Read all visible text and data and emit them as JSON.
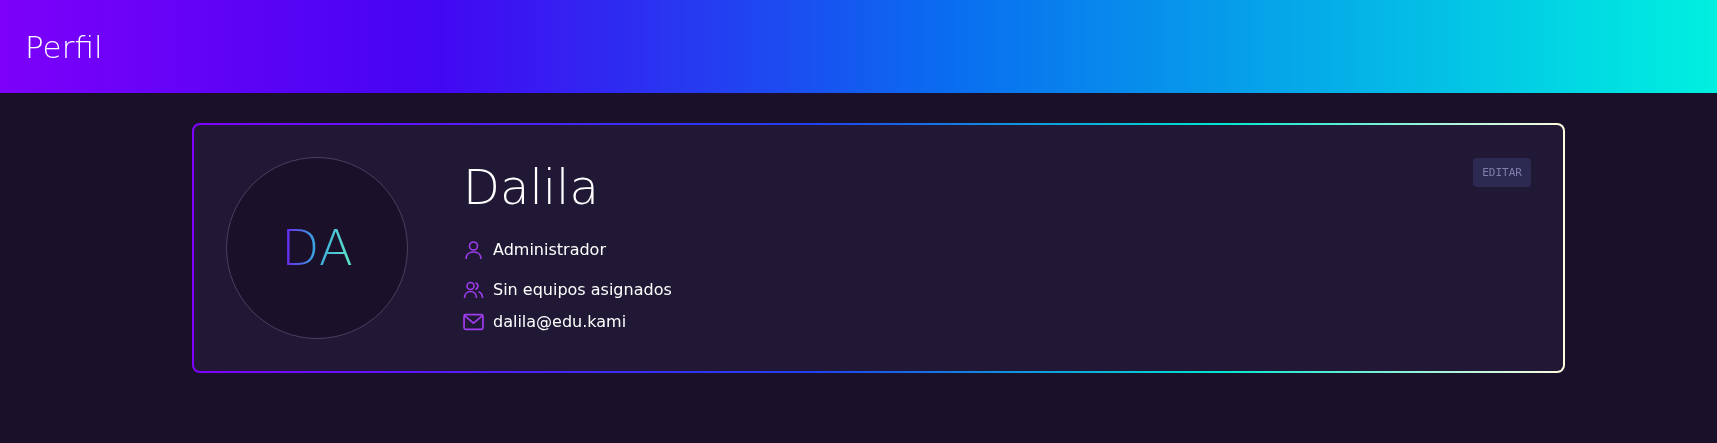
{
  "header": {
    "title": "Perfil"
  },
  "profile": {
    "initials": "DA",
    "name": "Dalila",
    "edit_button": "EDITAR",
    "details": [
      {
        "kind": "role",
        "text": "Administrador"
      },
      {
        "kind": "teams",
        "text": "Sin equipos asignados"
      },
      {
        "kind": "email",
        "text": "dalila@edu.kami"
      }
    ]
  }
}
